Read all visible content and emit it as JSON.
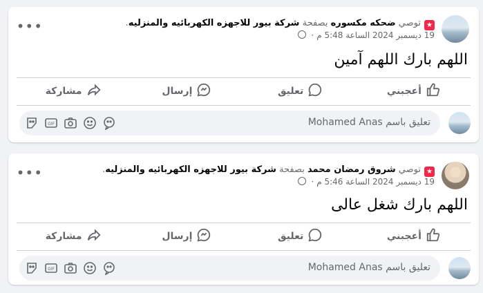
{
  "posts": [
    {
      "recommend_label": "توصي",
      "author": "ضحكه مكسوره",
      "on_page": "بصفحة",
      "page": "شركة بيور للاجهزه الكهربائيه والمنزليه",
      "period": ".",
      "timestamp": "19 ديسمبر 2024 الساعة 5:48 م",
      "dot": "·",
      "text": "اللهم بارك اللهم آمين",
      "actions": {
        "like": "أعجبني",
        "comment": "تعليق",
        "send": "إرسال",
        "share": "مشاركة"
      },
      "comment_placeholder": "تعليق باسم Mohamed Anas"
    },
    {
      "recommend_label": "توصي",
      "author": "شروق رمضان محمد",
      "on_page": "بصفحة",
      "page": "شركة بيور للاجهزه الكهربائيه والمنزليه",
      "period": ".",
      "timestamp": "19 ديسمبر 2024 الساعة 5:46 م",
      "dot": "·",
      "text": "اللهم بارك شغل عالى",
      "actions": {
        "like": "أعجبني",
        "comment": "تعليق",
        "send": "إرسال",
        "share": "مشاركة"
      },
      "comment_placeholder": "تعليق باسم Mohamed Anas"
    }
  ],
  "colors": {
    "badge": "#f02849",
    "secondary_text": "#65676b",
    "divider": "#ced0d4",
    "background": "#f0f2f5"
  },
  "icons": [
    "recommend-badge-icon",
    "globe-icon",
    "more-icon",
    "like-icon",
    "comment-icon",
    "send-icon",
    "share-icon",
    "sticker-icon",
    "gif-icon",
    "camera-icon",
    "emoji-icon",
    "avatar-sticker-icon"
  ]
}
